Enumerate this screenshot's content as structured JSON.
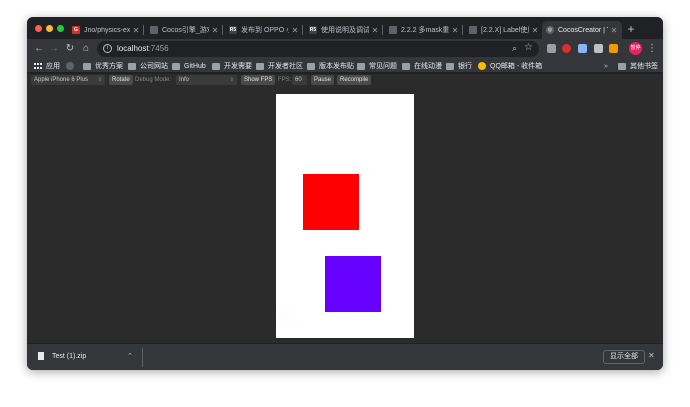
{
  "colors": {
    "red_square": "#ff0000",
    "purple_square": "#6600ff",
    "canvas_bg": "#ffffff",
    "profile_badge": "#e91e63"
  },
  "tabs": [
    {
      "title": "Jno/physics-exa",
      "favicon": "G"
    },
    {
      "title": "Cocos引擎_游戏开",
      "favicon": ""
    },
    {
      "title": "发布到 OPPO 小游",
      "favicon": "R5"
    },
    {
      "title": "使用说明及调试",
      "favicon": "R5"
    },
    {
      "title": "2.2.2 多mask重叠",
      "favicon": ""
    },
    {
      "title": "[2.2.X] Label使用",
      "favicon": ""
    },
    {
      "title": "CocosCreator | Ti",
      "favicon": "◎"
    }
  ],
  "toolbar": {
    "url_host": "localhost",
    "url_port": ":7456",
    "profile_label": "暂停"
  },
  "bookmarks": [
    {
      "label": "应用"
    },
    {
      "label": ""
    },
    {
      "label": "优秀方案"
    },
    {
      "label": "公司网站"
    },
    {
      "label": "GitHub"
    },
    {
      "label": "开发需要"
    },
    {
      "label": "开发者社区"
    },
    {
      "label": "版本发布贴"
    },
    {
      "label": "常见问题"
    },
    {
      "label": "在线动漫"
    },
    {
      "label": "银行"
    },
    {
      "label": "QQ邮箱 - 收件箱"
    },
    {
      "label": "其他书签"
    }
  ],
  "preview": {
    "device": "Apple iPhone 6 Plus",
    "rotate": "Rotate",
    "debug_label": "Debug Mode:",
    "debug_value": "Info",
    "show_fps": "Show FPS",
    "fps_label": "FPS:",
    "fps_value": "60",
    "pause": "Pause",
    "recompile": "Recompile"
  },
  "downloads": {
    "file_name": "Test (1).zip",
    "show_all": "显示全部"
  }
}
